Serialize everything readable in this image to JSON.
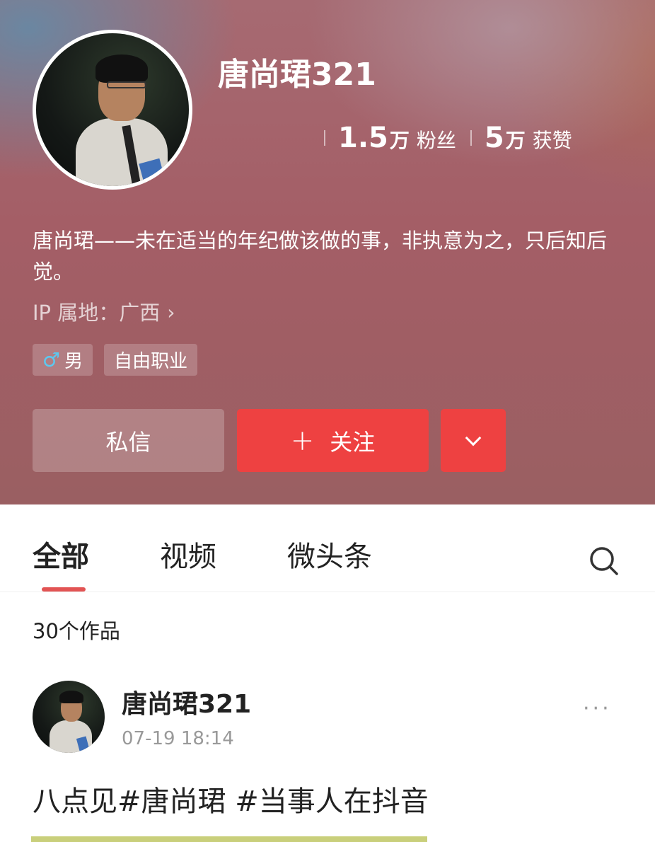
{
  "profile": {
    "username": "唐尚珺321",
    "followers_num": "1.5",
    "followers_unit": "万",
    "followers_label": "粉丝",
    "likes_num": "5",
    "likes_unit": "万",
    "likes_label": "获赞",
    "bio": "唐尚珺——未在适当的年纪做该做的事，非执意为之，只后知后觉。",
    "ip_location": "IP 属地：广西",
    "tags": [
      "男",
      "自由职业"
    ],
    "icons": {
      "gender": "male-symbol-icon",
      "ip_arrow": "chevron-right-icon"
    }
  },
  "actions": {
    "message_label": "私信",
    "follow_label": "关注",
    "follow_icon": "plus-icon",
    "more_icon": "chevron-down-icon"
  },
  "tabs": {
    "items": [
      "全部",
      "视频",
      "微头条"
    ],
    "active_index": 0,
    "search_icon": "search-icon"
  },
  "works_count": "30个作品",
  "post": {
    "author": "唐尚珺321",
    "time": "07-19  18:14",
    "text": "八点见#唐尚珺  #当事人在抖音",
    "more_icon": "more-dots-icon"
  },
  "colors": {
    "accent": "#ee4141",
    "tab_underline": "#e25353",
    "male_icon": "#5cc8f0"
  }
}
